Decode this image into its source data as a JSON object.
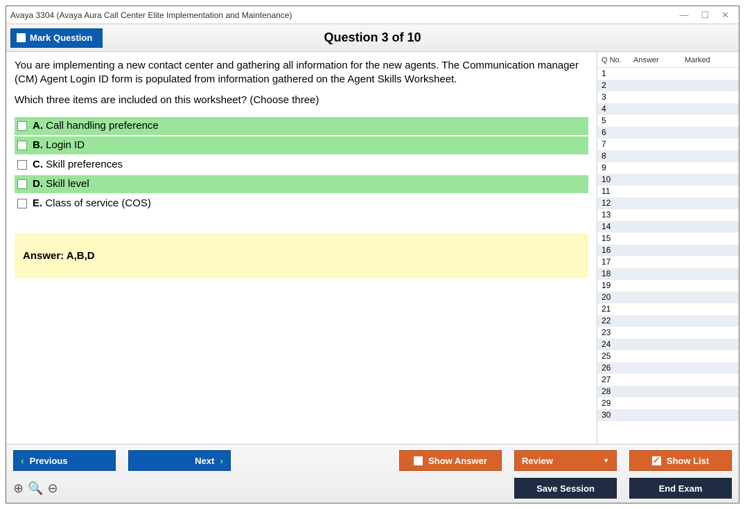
{
  "window": {
    "title": "Avaya 3304 (Avaya Aura Call Center Elite Implementation and Maintenance)"
  },
  "header": {
    "mark_label": "Mark Question",
    "question_counter": "Question 3 of 10"
  },
  "question": {
    "body_1": "You are implementing a new contact center and gathering all information for the new agents. The Communication manager (CM) Agent Login ID form is populated from information gathered on the Agent Skills Worksheet.",
    "body_2": "Which three items are included on this worksheet? (Choose three)"
  },
  "answers": [
    {
      "letter": "A.",
      "text": "Call handling preference",
      "correct": true
    },
    {
      "letter": "B.",
      "text": "Login ID",
      "correct": true
    },
    {
      "letter": "C.",
      "text": "Skill preferences",
      "correct": false
    },
    {
      "letter": "D.",
      "text": "Skill level",
      "correct": true
    },
    {
      "letter": "E.",
      "text": "Class of service (COS)",
      "correct": false
    }
  ],
  "answer_panel": {
    "text": "Answer: A,B,D"
  },
  "sidepanel": {
    "col_qno": "Q No.",
    "col_answer": "Answer",
    "col_marked": "Marked",
    "rows": 30
  },
  "footer": {
    "previous": "Previous",
    "next": "Next",
    "show_answer": "Show Answer",
    "review": "Review",
    "show_list": "Show List",
    "save_session": "Save Session",
    "end_exam": "End Exam"
  }
}
